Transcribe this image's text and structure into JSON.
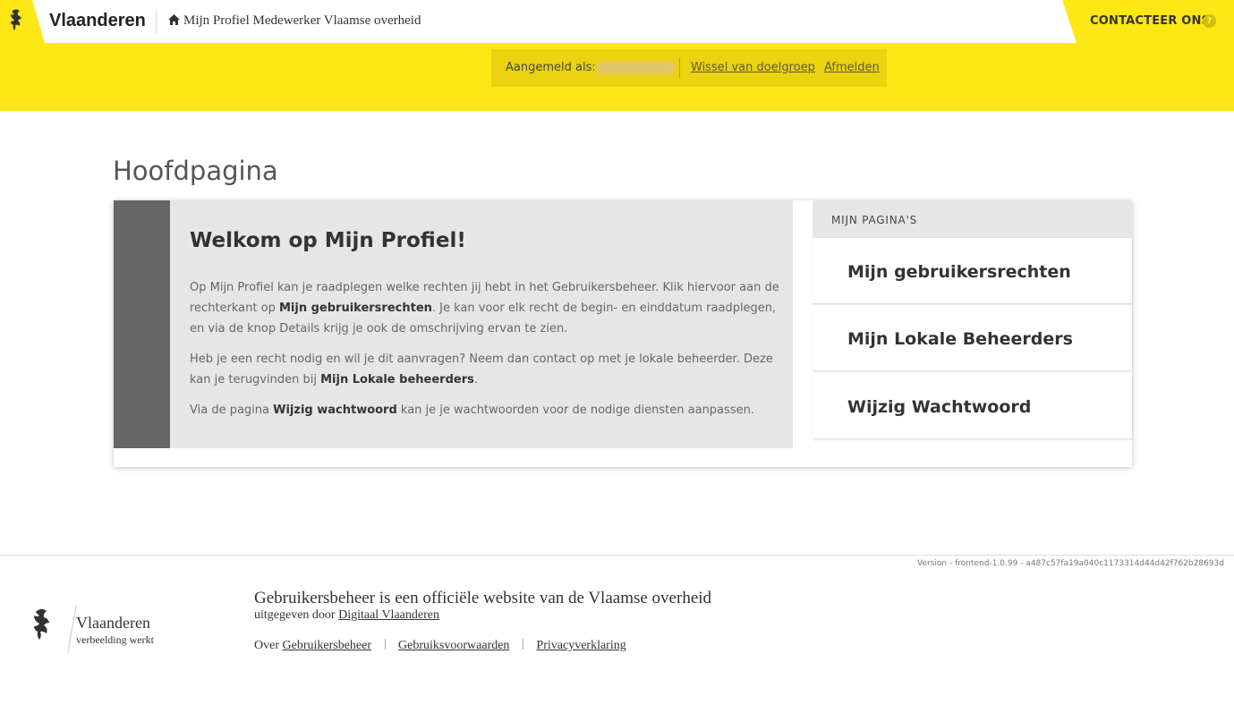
{
  "header": {
    "brand": "Vlaanderen",
    "breadcrumb": "Mijn Profiel Medewerker Vlaamse overheid",
    "contact": "CONTACTEER ONS",
    "help": "?"
  },
  "login": {
    "label": "Aangemeld als:",
    "switch": "Wissel van doelgroep",
    "logout": "Afmelden"
  },
  "main": {
    "title": "Hoofdpagina",
    "welcome_title": "Welkom op Mijn Profiel!",
    "p1_a": "Op Mijn Profiel kan je raadplegen welke rechten jij hebt in het Gebruikersbeheer. Klik hiervoor aan de rechterkant op ",
    "p1_b": "Mijn gebruikersrechten",
    "p1_c": ". Je kan voor elk recht de begin- en einddatum raadplegen, en via de knop Details krijg je ook de omschrijving ervan te zien.",
    "p2_a": "Heb je een recht nodig en wil je dit aanvragen? Neem dan contact op met je lokale beheerder. Deze kan je terugvinden bij ",
    "p2_b": "Mijn Lokale beheerders",
    "p2_c": ".",
    "p3_a": "Via de pagina ",
    "p3_b": "Wijzig wachtwoord",
    "p3_c": " kan je je wachtwoorden voor de nodige diensten aanpassen."
  },
  "sidebar": {
    "title": "MIJN PAGINA'S",
    "items": [
      {
        "label": "Mijn gebruikersrechten"
      },
      {
        "label": "Mijn Lokale Beheerders"
      },
      {
        "label": "Wijzig Wachtwoord"
      }
    ]
  },
  "footer": {
    "version": "Version - frontend-1.0.99 - a487c57fa19a040c1173314d44d42f762b28693d",
    "brand": "Vlaanderen",
    "tagline": "verbeelding werkt",
    "title": "Gebruikersbeheer is een officiële website van de Vlaamse overheid",
    "publisher_prefix": "uitgegeven door",
    "publisher": "Digitaal Vlaanderen",
    "about_prefix": "Over",
    "about": "Gebruikersbeheer",
    "terms": "Gebruiksvoorwaarden",
    "privacy": "Privacyverklaring"
  },
  "colors": {
    "accent": "#ffe615",
    "login_box": "#ebd30f",
    "welcome_bar": "#666666"
  }
}
